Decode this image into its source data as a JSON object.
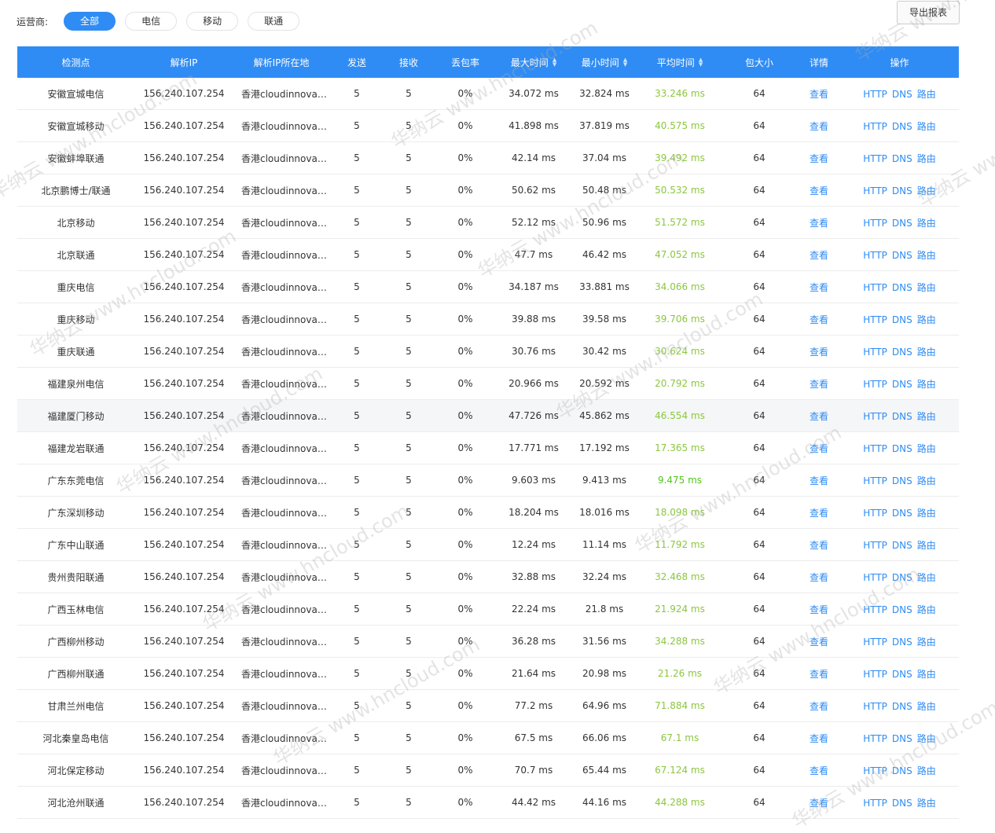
{
  "filter": {
    "label": "运营商:",
    "options": [
      {
        "label": "全部",
        "active": true
      },
      {
        "label": "电信",
        "active": false
      },
      {
        "label": "移动",
        "active": false
      },
      {
        "label": "联通",
        "active": false
      }
    ]
  },
  "export_label": "导出报表",
  "colors": {
    "accent": "#2f8cf4",
    "avg_time": "#8cc63f",
    "avg_best": "#52c41a"
  },
  "columns": [
    {
      "key": "node",
      "label": "检测点",
      "sortable": false
    },
    {
      "key": "ip",
      "label": "解析IP",
      "sortable": false
    },
    {
      "key": "region",
      "label": "解析IP所在地",
      "sortable": false
    },
    {
      "key": "sent",
      "label": "发送",
      "sortable": false
    },
    {
      "key": "recv",
      "label": "接收",
      "sortable": false
    },
    {
      "key": "loss",
      "label": "丢包率",
      "sortable": false
    },
    {
      "key": "max",
      "label": "最大时间",
      "sortable": true
    },
    {
      "key": "min",
      "label": "最小时间",
      "sortable": true
    },
    {
      "key": "avg",
      "label": "平均时间",
      "sortable": true
    },
    {
      "key": "size",
      "label": "包大小",
      "sortable": false
    },
    {
      "key": "detail",
      "label": "详情",
      "sortable": false
    },
    {
      "key": "ops",
      "label": "操作",
      "sortable": false
    }
  ],
  "sort_icons": {
    "up": "▲",
    "down": "▼"
  },
  "detail_label": "查看",
  "ops_labels": [
    "HTTP",
    "DNS",
    "路由"
  ],
  "rows": [
    {
      "node": "安徽宣城电信",
      "ip": "156.240.107.254",
      "region": "香港cloudinnovatio…",
      "sent": "5",
      "recv": "5",
      "loss": "0%",
      "max": "34.072 ms",
      "min": "32.824 ms",
      "avg": "33.246 ms",
      "size": "64"
    },
    {
      "node": "安徽宣城移动",
      "ip": "156.240.107.254",
      "region": "香港cloudinnovatio…",
      "sent": "5",
      "recv": "5",
      "loss": "0%",
      "max": "41.898 ms",
      "min": "37.819 ms",
      "avg": "40.575 ms",
      "size": "64"
    },
    {
      "node": "安徽蚌埠联通",
      "ip": "156.240.107.254",
      "region": "香港cloudinnovatio…",
      "sent": "5",
      "recv": "5",
      "loss": "0%",
      "max": "42.14 ms",
      "min": "37.04 ms",
      "avg": "39.492 ms",
      "size": "64"
    },
    {
      "node": "北京鹏博士/联通",
      "ip": "156.240.107.254",
      "region": "香港cloudinnovatio…",
      "sent": "5",
      "recv": "5",
      "loss": "0%",
      "max": "50.62 ms",
      "min": "50.48 ms",
      "avg": "50.532 ms",
      "size": "64"
    },
    {
      "node": "北京移动",
      "ip": "156.240.107.254",
      "region": "香港cloudinnovatio…",
      "sent": "5",
      "recv": "5",
      "loss": "0%",
      "max": "52.12 ms",
      "min": "50.96 ms",
      "avg": "51.572 ms",
      "size": "64"
    },
    {
      "node": "北京联通",
      "ip": "156.240.107.254",
      "region": "香港cloudinnovatio…",
      "sent": "5",
      "recv": "5",
      "loss": "0%",
      "max": "47.7 ms",
      "min": "46.42 ms",
      "avg": "47.052 ms",
      "size": "64"
    },
    {
      "node": "重庆电信",
      "ip": "156.240.107.254",
      "region": "香港cloudinnovatio…",
      "sent": "5",
      "recv": "5",
      "loss": "0%",
      "max": "34.187 ms",
      "min": "33.881 ms",
      "avg": "34.066 ms",
      "size": "64"
    },
    {
      "node": "重庆移动",
      "ip": "156.240.107.254",
      "region": "香港cloudinnovatio…",
      "sent": "5",
      "recv": "5",
      "loss": "0%",
      "max": "39.88 ms",
      "min": "39.58 ms",
      "avg": "39.706 ms",
      "size": "64"
    },
    {
      "node": "重庆联通",
      "ip": "156.240.107.254",
      "region": "香港cloudinnovatio…",
      "sent": "5",
      "recv": "5",
      "loss": "0%",
      "max": "30.76 ms",
      "min": "30.42 ms",
      "avg": "30.624 ms",
      "size": "64"
    },
    {
      "node": "福建泉州电信",
      "ip": "156.240.107.254",
      "region": "香港cloudinnovatio…",
      "sent": "5",
      "recv": "5",
      "loss": "0%",
      "max": "20.966 ms",
      "min": "20.592 ms",
      "avg": "20.792 ms",
      "size": "64"
    },
    {
      "node": "福建厦门移动",
      "ip": "156.240.107.254",
      "region": "香港cloudinnovatio…",
      "sent": "5",
      "recv": "5",
      "loss": "0%",
      "max": "47.726 ms",
      "min": "45.862 ms",
      "avg": "46.554 ms",
      "size": "64",
      "highlight": true
    },
    {
      "node": "福建龙岩联通",
      "ip": "156.240.107.254",
      "region": "香港cloudinnovatio…",
      "sent": "5",
      "recv": "5",
      "loss": "0%",
      "max": "17.771 ms",
      "min": "17.192 ms",
      "avg": "17.365 ms",
      "size": "64"
    },
    {
      "node": "广东东莞电信",
      "ip": "156.240.107.254",
      "region": "香港cloudinnovatio…",
      "sent": "5",
      "recv": "5",
      "loss": "0%",
      "max": "9.603 ms",
      "min": "9.413 ms",
      "avg": "9.475 ms",
      "size": "64",
      "best": true
    },
    {
      "node": "广东深圳移动",
      "ip": "156.240.107.254",
      "region": "香港cloudinnovatio…",
      "sent": "5",
      "recv": "5",
      "loss": "0%",
      "max": "18.204 ms",
      "min": "18.016 ms",
      "avg": "18.098 ms",
      "size": "64"
    },
    {
      "node": "广东中山联通",
      "ip": "156.240.107.254",
      "region": "香港cloudinnovatio…",
      "sent": "5",
      "recv": "5",
      "loss": "0%",
      "max": "12.24 ms",
      "min": "11.14 ms",
      "avg": "11.792 ms",
      "size": "64"
    },
    {
      "node": "贵州贵阳联通",
      "ip": "156.240.107.254",
      "region": "香港cloudinnovatio…",
      "sent": "5",
      "recv": "5",
      "loss": "0%",
      "max": "32.88 ms",
      "min": "32.24 ms",
      "avg": "32.468 ms",
      "size": "64"
    },
    {
      "node": "广西玉林电信",
      "ip": "156.240.107.254",
      "region": "香港cloudinnovatio…",
      "sent": "5",
      "recv": "5",
      "loss": "0%",
      "max": "22.24 ms",
      "min": "21.8 ms",
      "avg": "21.924 ms",
      "size": "64"
    },
    {
      "node": "广西柳州移动",
      "ip": "156.240.107.254",
      "region": "香港cloudinnovatio…",
      "sent": "5",
      "recv": "5",
      "loss": "0%",
      "max": "36.28 ms",
      "min": "31.56 ms",
      "avg": "34.288 ms",
      "size": "64"
    },
    {
      "node": "广西柳州联通",
      "ip": "156.240.107.254",
      "region": "香港cloudinnovatio…",
      "sent": "5",
      "recv": "5",
      "loss": "0%",
      "max": "21.64 ms",
      "min": "20.98 ms",
      "avg": "21.26 ms",
      "size": "64"
    },
    {
      "node": "甘肃兰州电信",
      "ip": "156.240.107.254",
      "region": "香港cloudinnovatio…",
      "sent": "5",
      "recv": "5",
      "loss": "0%",
      "max": "77.2 ms",
      "min": "64.96 ms",
      "avg": "71.884 ms",
      "size": "64"
    },
    {
      "node": "河北秦皇岛电信",
      "ip": "156.240.107.254",
      "region": "香港cloudinnovatio…",
      "sent": "5",
      "recv": "5",
      "loss": "0%",
      "max": "67.5 ms",
      "min": "66.06 ms",
      "avg": "67.1 ms",
      "size": "64"
    },
    {
      "node": "河北保定移动",
      "ip": "156.240.107.254",
      "region": "香港cloudinnovatio…",
      "sent": "5",
      "recv": "5",
      "loss": "0%",
      "max": "70.7 ms",
      "min": "65.44 ms",
      "avg": "67.124 ms",
      "size": "64"
    },
    {
      "node": "河北沧州联通",
      "ip": "156.240.107.254",
      "region": "香港cloudinnovatio…",
      "sent": "5",
      "recv": "5",
      "loss": "0%",
      "max": "44.42 ms",
      "min": "44.16 ms",
      "avg": "44.288 ms",
      "size": "64"
    }
  ],
  "watermark": "华纳云 www.hncloud.com"
}
